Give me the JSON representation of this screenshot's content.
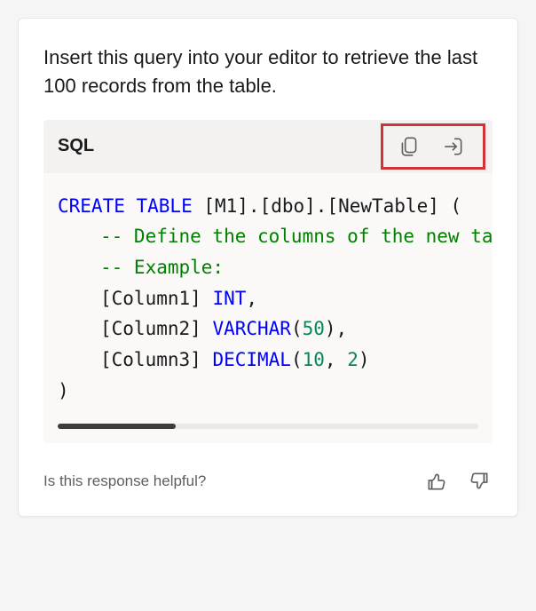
{
  "description": "Insert this query into your editor to retrieve the last 100 records from the table.",
  "code": {
    "lang": "SQL",
    "lines": {
      "l0_kw": "CREATE TABLE",
      "l0_ident": " [M1].[dbo].[NewTable] (",
      "l1_cm": "-- Define the columns of the new tabl",
      "l2_cm": "-- Example:",
      "l3_ident": "[Column1] ",
      "l3_type": "INT",
      "l3_tail": ",",
      "l4_ident": "[Column2] ",
      "l4_type": "VARCHAR",
      "l4_open": "(",
      "l4_num": "50",
      "l4_close": "),",
      "l5_ident": "[Column3] ",
      "l5_type": "DECIMAL",
      "l5_open": "(",
      "l5_n1": "10",
      "l5_comma": ", ",
      "l5_n2": "2",
      "l5_close": ")",
      "l6": ")"
    }
  },
  "footer": {
    "prompt": "Is this response helpful?"
  }
}
